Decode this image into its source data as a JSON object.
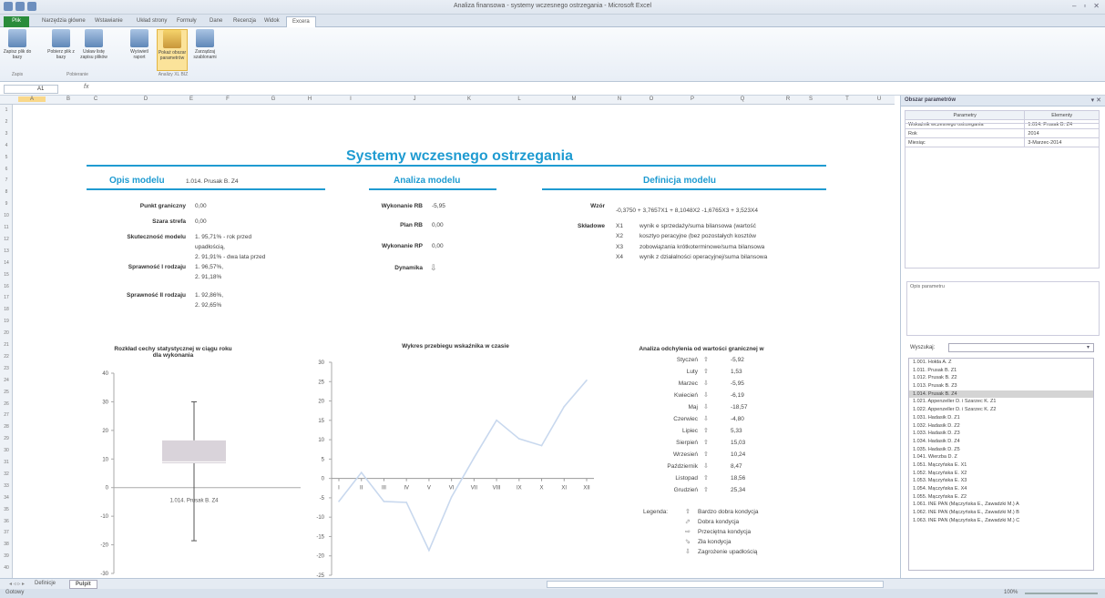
{
  "window": {
    "title": "Analiza finansowa - systemy wczesnego ostrzegania - Microsoft Excel"
  },
  "ribbon_tabs": [
    "Plik",
    "Narzędzia główne",
    "Wstawianie",
    "Układ strony",
    "Formuły",
    "Dane",
    "Recenzja",
    "Widok",
    "Excera"
  ],
  "ribbon": {
    "buttons": [
      "Zapisz plik do bazy",
      "Pobierz plik z bazy",
      "Usław listę zapisu plików",
      "Wyświetl raport",
      "Pokaż obszar parametrów",
      "Zarządzaj szablonami"
    ],
    "groups": [
      "Zapis",
      "Pobieranie",
      "Analizy XL BIZ"
    ]
  },
  "formula_bar": {
    "namebox": "A1",
    "fx": "fx"
  },
  "columns": [
    "A",
    "B",
    "C",
    "D",
    "E",
    "F",
    "G",
    "H",
    "I",
    "J",
    "K",
    "L",
    "M",
    "N",
    "O",
    "P",
    "Q",
    "R",
    "S",
    "T",
    "U"
  ],
  "rows": [
    "1",
    "2",
    "3",
    "4",
    "5",
    "6",
    "7",
    "8",
    "9",
    "10",
    "11",
    "12",
    "13",
    "14",
    "15",
    "16",
    "17",
    "18",
    "19",
    "20",
    "21",
    "22",
    "23",
    "24",
    "25",
    "26",
    "27",
    "28",
    "29",
    "30",
    "31",
    "32",
    "33",
    "34",
    "35",
    "36",
    "37",
    "38",
    "39",
    "40"
  ],
  "dashboard": {
    "title": "Systemy wczesnego ostrzegania",
    "opis": {
      "header": "Opis modelu",
      "model_name": "1.014. Prusak B. Z4",
      "punkt_label": "Punkt graniczny",
      "punkt_val": "0,00",
      "szara_label": "Szara strefa",
      "szara_val": "0,00",
      "skut_label": "Skuteczność modelu",
      "skut_val1": "1. 95,71% - rok przed",
      "skut_val2": "upadłością,",
      "skut_val3": "2. 91,91% - dwa lata przed",
      "spr1_label": "Sprawność I rodzaju",
      "spr1_val1": "1. 96,57%,",
      "spr1_val2": "2. 91,18%",
      "spr2_label": "Sprawność II rodzaju",
      "spr2_val1": "1. 92,86%,",
      "spr2_val2": "2. 92,65%"
    },
    "analiza": {
      "header": "Analiza modelu",
      "wrb_label": "Wykonanie RB",
      "wrb_val": "-5,95",
      "prb_label": "Plan RB",
      "prb_val": "0,00",
      "wrp_label": "Wykonanie RP",
      "wrp_val": "0,00",
      "dyn_label": "Dynamika",
      "dyn_icon": "arrow-down"
    },
    "definicja": {
      "header": "Definicja modelu",
      "wzor_label": "Wzór",
      "wzor_val": "-0,3750 + 3,7657X1 + 8,1048X2 -1,6765X3 + 3,523X4",
      "skl_label": "Składowe",
      "components": [
        {
          "code": "X1",
          "desc": "wynik e sprzedaży/suma bilansowa (wartość"
        },
        {
          "code": "X2",
          "desc": "kosztyo peracyjne (bez pozostałych kosztów"
        },
        {
          "code": "X3",
          "desc": "zobowiązania krótkoterminowe/suma bilansowa"
        },
        {
          "code": "X4",
          "desc": "wynik z działalności operacyjnej/suma bilansowa"
        }
      ]
    }
  },
  "chart_data": [
    {
      "type": "box",
      "title": "Rozkład cechy statystycznej w ciągu roku dla wykonania",
      "category": "1.014. Prusak B. Z4",
      "min": -18.57,
      "q1": 8.5,
      "median": 9,
      "q3": 16.5,
      "max": 30,
      "ylim": [
        -30,
        40
      ],
      "yticks": [
        "40",
        "30",
        "20",
        "10",
        "0",
        "-10",
        "-20",
        "-30"
      ]
    },
    {
      "type": "line",
      "title": "Wykres przebiegu wskaźnika w czasie",
      "categories": [
        "I",
        "II",
        "III",
        "IV",
        "V",
        "VI",
        "VII",
        "VIII",
        "IX",
        "X",
        "XI",
        "XII"
      ],
      "values": [
        -5.92,
        1.53,
        -5.95,
        -6.19,
        -18.57,
        -4.8,
        5.33,
        15.03,
        10.24,
        8.47,
        18.56,
        25.34
      ],
      "ylim": [
        -25,
        30
      ],
      "yticks": [
        "30",
        "25",
        "20",
        "15",
        "10",
        "5",
        "0",
        "-5",
        "-10",
        "-15",
        "-20",
        "-25"
      ]
    }
  ],
  "deviation": {
    "title": "Analiza odchylenia od wartości granicznej w",
    "rows": [
      {
        "month": "Styczeń",
        "dir": "up",
        "value": "-5,92"
      },
      {
        "month": "Luty",
        "dir": "up",
        "value": "1,53"
      },
      {
        "month": "Marzec",
        "dir": "down",
        "value": "-5,95"
      },
      {
        "month": "Kwiecień",
        "dir": "down",
        "value": "-6,19"
      },
      {
        "month": "Maj",
        "dir": "down",
        "value": "-18,57"
      },
      {
        "month": "Czerwiec",
        "dir": "down",
        "value": "-4,80"
      },
      {
        "month": "Lipiec",
        "dir": "up",
        "value": "5,33"
      },
      {
        "month": "Sierpień",
        "dir": "up",
        "value": "15,03"
      },
      {
        "month": "Wrzesień",
        "dir": "up",
        "value": "10,24"
      },
      {
        "month": "Październik",
        "dir": "down",
        "value": "8,47"
      },
      {
        "month": "Listopad",
        "dir": "up",
        "value": "18,56"
      },
      {
        "month": "Grudzień",
        "dir": "up",
        "value": "25,34"
      }
    ],
    "legend_label": "Legenda:",
    "legend": [
      {
        "glyph": "⇧",
        "text": "Bardzo dobra kondycja"
      },
      {
        "glyph": "⬀",
        "text": "Dobra kondycja"
      },
      {
        "glyph": "⇨",
        "text": "Przeciętna kondycja"
      },
      {
        "glyph": "⬂",
        "text": "Zła kondycja"
      },
      {
        "glyph": "⇩",
        "text": "Zagrożenie upadłością"
      }
    ]
  },
  "sheet_tabs": [
    "Definicje",
    "Pulpit"
  ],
  "status": "Gotowy",
  "zoom": "100%",
  "param_panel": {
    "title": "Obszar parametrów",
    "col1": "Parametry",
    "col2": "Elementy",
    "rows": [
      {
        "p": "Wskaźnik wczesnego ostrzegania",
        "e": "1.014. Prusak B. Z4"
      },
      {
        "p": "Rok",
        "e": "2014"
      },
      {
        "p": "Miesiąc",
        "e": "3-Marzec-2014"
      }
    ],
    "opis_label": "Opis parametru",
    "search_label": "Wyszukaj:",
    "list": [
      "1.001. Hołda A. Z",
      "1.011. Prusak B. Z1",
      "1.012. Prusak B. Z2",
      "1.013. Prusak B. Z3",
      "1.014. Prusak B. Z4",
      "1.021. Appenzeller D. i Szarzec K. Z1",
      "1.022. Appenzeller D. i Szarzec K. Z2",
      "1.031. Hadasik D. Z1",
      "1.032. Hadasik D. Z2",
      "1.033. Hadasik D. Z3",
      "1.034. Hadasik D. Z4",
      "1.035. Hadasik D. Z5",
      "1.041. Wierzba D. Z",
      "1.051. Mączyńska E. X1",
      "1.052. Mączyńska E. X2",
      "1.053. Mączyńska E. X3",
      "1.054. Mączyńska E. X4",
      "1.055. Mączyńska E. Z2",
      "1.061. INE PAN (Mączyńska E., Zawadzki M.) A",
      "1.062. INE PAN (Mączyńska E., Zawadzki M.) B",
      "1.063. INE PAN (Mączyńska E., Zawadzki M.) C"
    ],
    "selected_index": 4
  }
}
